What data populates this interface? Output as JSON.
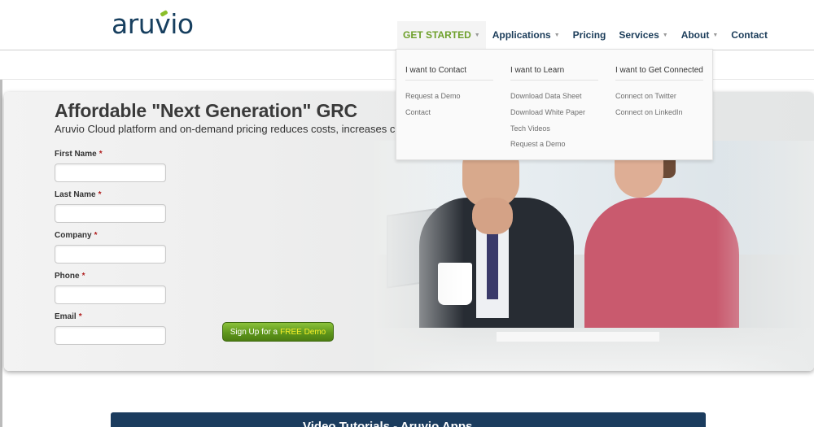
{
  "header": {
    "logo_text": "aruvio",
    "nav": [
      {
        "label": "GET STARTED",
        "has_caret": true,
        "active": true
      },
      {
        "label": "Applications",
        "has_caret": true,
        "active": false
      },
      {
        "label": "Pricing",
        "has_caret": false,
        "active": false
      },
      {
        "label": "Services",
        "has_caret": true,
        "active": false
      },
      {
        "label": "About",
        "has_caret": true,
        "active": false
      },
      {
        "label": "Contact",
        "has_caret": false,
        "active": false
      }
    ]
  },
  "dropdown": {
    "columns": [
      {
        "heading": "I want to Contact",
        "links": [
          "Request a Demo",
          "Contact"
        ]
      },
      {
        "heading": "I want to Learn",
        "links": [
          "Download Data Sheet",
          "Download White Paper",
          "Tech Videos",
          "Request a Demo"
        ]
      },
      {
        "heading": "I want to Get Connected",
        "links": [
          "Connect on Twitter",
          "Connect on LinkedIn"
        ]
      }
    ]
  },
  "hero": {
    "title": "Affordable \"Next Generation\" GRC",
    "subtitle": "Aruvio Cloud platform and on-demand pricing reduces costs, increases custom",
    "form": {
      "fields": [
        {
          "label": "First Name",
          "required_mark": "*",
          "value": ""
        },
        {
          "label": "Last Name",
          "required_mark": "*",
          "value": ""
        },
        {
          "label": "Company",
          "required_mark": "*",
          "value": ""
        },
        {
          "label": "Phone",
          "required_mark": "*",
          "value": ""
        },
        {
          "label": "Email",
          "required_mark": "*",
          "value": ""
        }
      ],
      "submit_prefix": "Sign Up for a",
      "submit_highlight": "FREE Demo"
    }
  },
  "bottom_bar": {
    "text": "Video Tutorials - Aruvio Apps"
  },
  "colors": {
    "brand_navy": "#1c3d5a",
    "brand_green": "#6ea02b",
    "button_green": "#5f971b",
    "highlight_yellow": "#f7ef2a",
    "required_red": "#b01e1e"
  }
}
